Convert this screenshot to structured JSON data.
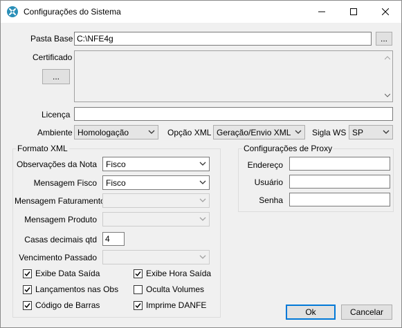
{
  "window": {
    "title": "Configurações do Sistema",
    "icon": "tools-icon"
  },
  "form": {
    "pasta_base_label": "Pasta Base",
    "pasta_base_value": "C:\\NFE4g",
    "browse_label": "...",
    "certificado_label": "Certificado",
    "certificado_button": "...",
    "licenca_label": "Licença",
    "licenca_value": "",
    "ambiente_label": "Ambiente",
    "ambiente_value": "Homologação",
    "opcao_xml_label": "Opção XML",
    "opcao_xml_value": "Geração/Envio XML",
    "sigla_ws_label": "Sigla WS",
    "sigla_ws_value": "SP"
  },
  "formato_xml": {
    "title": "Formato XML",
    "obs_nota_label": "Observações da Nota",
    "obs_nota_value": "Fisco",
    "msg_fisco_label": "Mensagem Fisco",
    "msg_fisco_value": "Fisco",
    "msg_faturamento_label": "Mensagem Faturamento",
    "msg_faturamento_value": "",
    "msg_produto_label": "Mensagem Produto",
    "msg_produto_value": "",
    "casas_decimais_label": "Casas decimais qtd",
    "casas_decimais_value": "4",
    "vencimento_label": "Vencimento Passado",
    "vencimento_value": ""
  },
  "checkboxes": {
    "exibe_data_saida": {
      "label": "Exibe Data Saída",
      "checked": true
    },
    "exibe_hora_saida": {
      "label": "Exibe Hora Saída",
      "checked": true
    },
    "lancamentos_obs": {
      "label": "Lançamentos nas Obs",
      "checked": true
    },
    "oculta_volumes": {
      "label": "Oculta Volumes",
      "checked": false
    },
    "codigo_barras": {
      "label": "Código de Barras",
      "checked": true
    },
    "imprime_danfe": {
      "label": "Imprime DANFE",
      "checked": true
    }
  },
  "proxy": {
    "title": "Configurações de Proxy",
    "endereco_label": "Endereço",
    "endereco_value": "",
    "usuario_label": "Usuário",
    "usuario_value": "",
    "senha_label": "Senha",
    "senha_value": ""
  },
  "buttons": {
    "ok": "Ok",
    "cancelar": "Cancelar"
  },
  "colors": {
    "accent": "#0078d7",
    "window_bg": "#f0f0f0"
  }
}
